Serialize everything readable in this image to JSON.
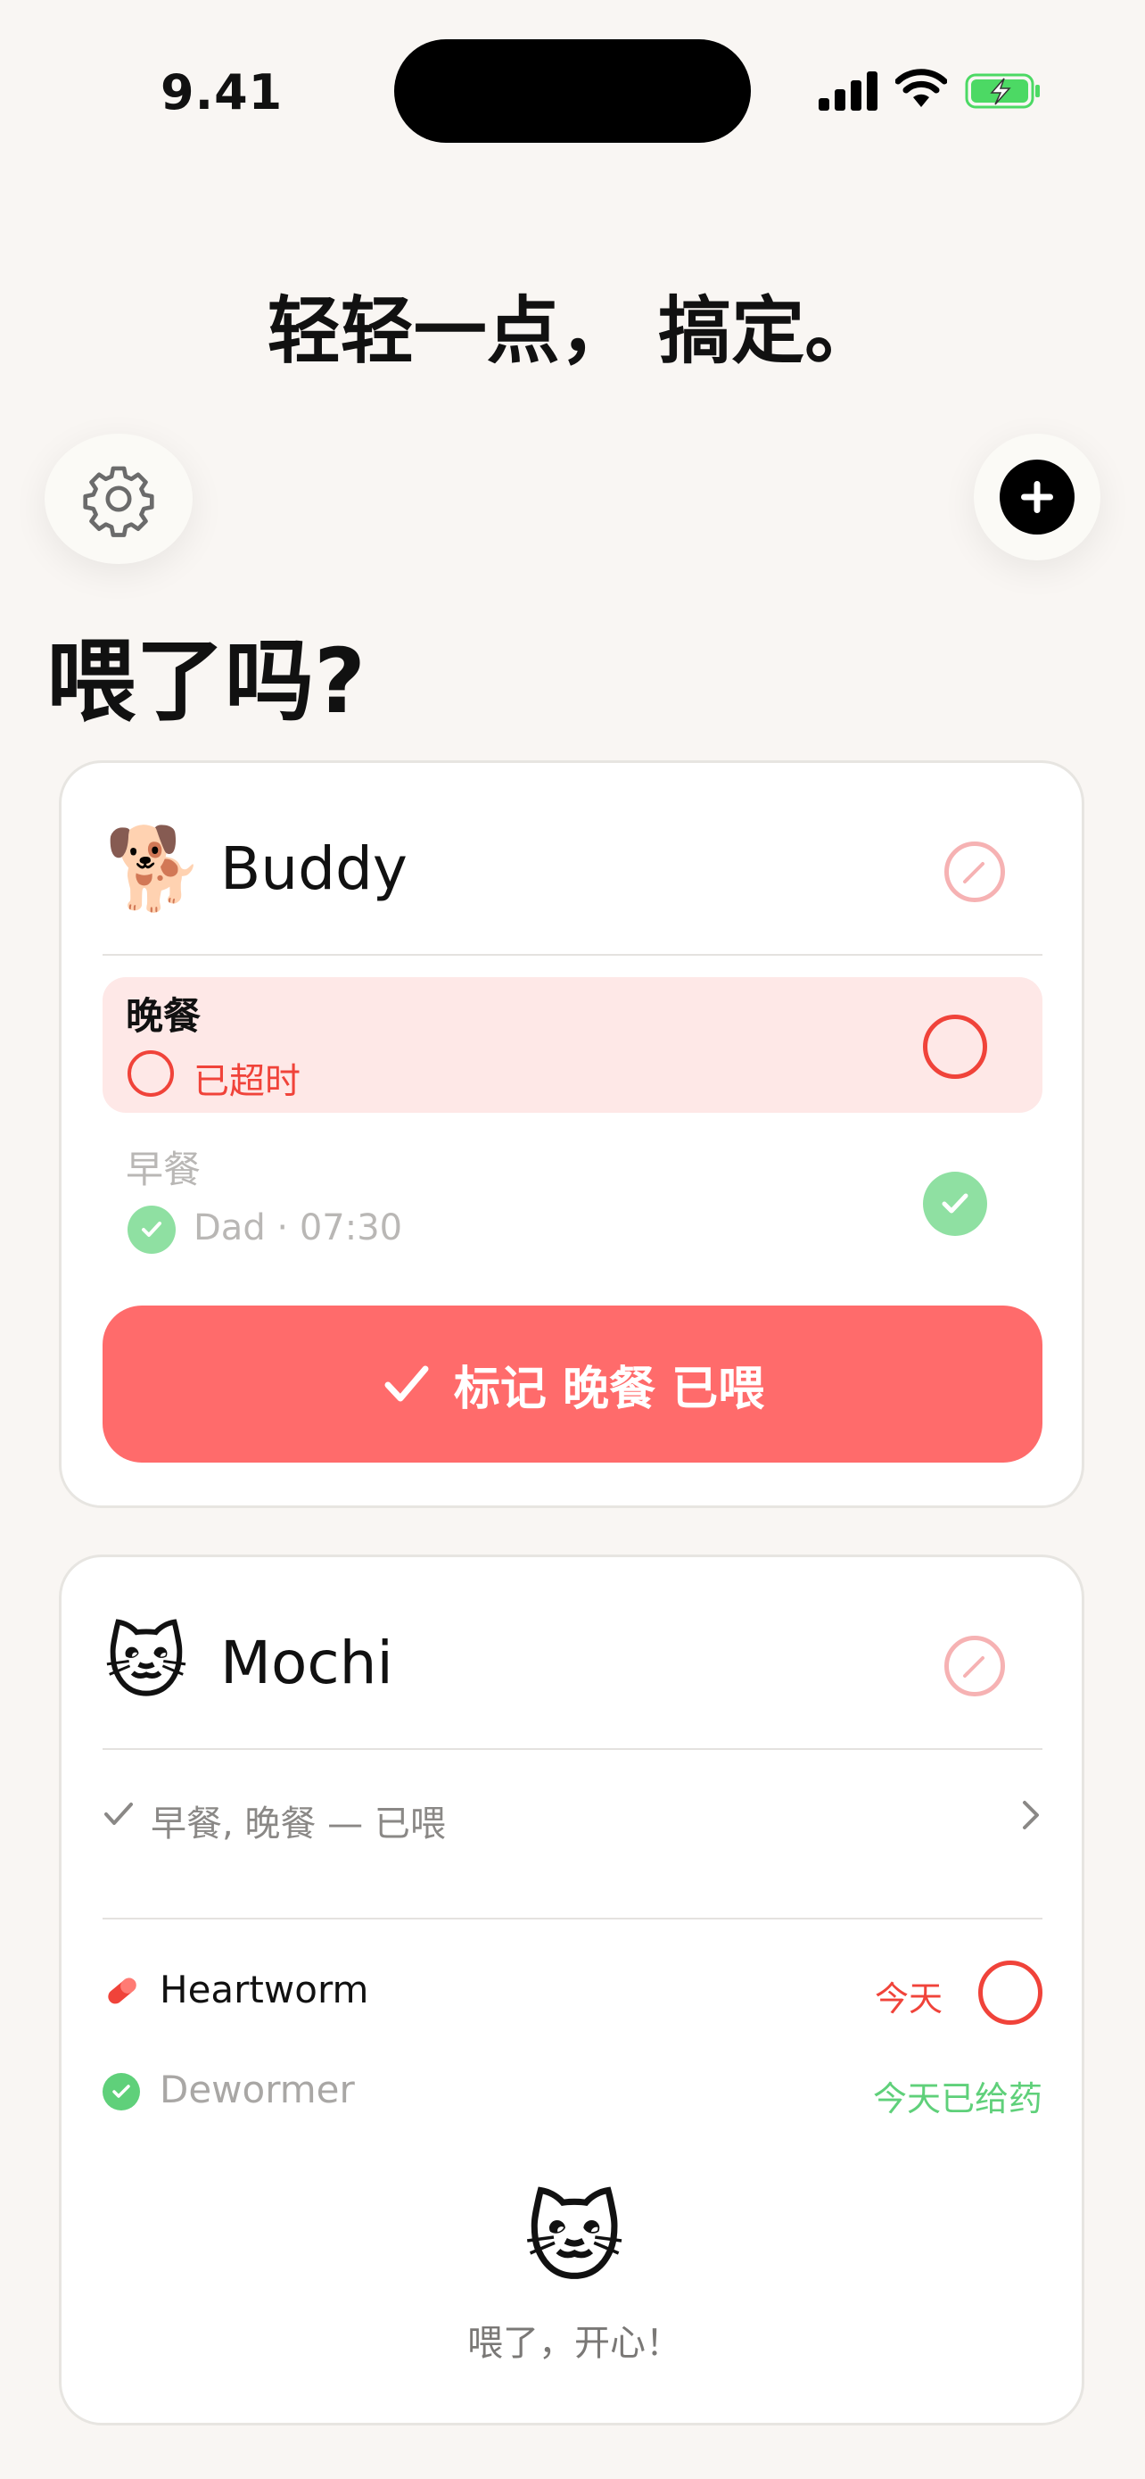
{
  "status_bar": {
    "time": "9.41"
  },
  "headline": "轻轻一点， 搞定。",
  "page_title": "喂了吗?",
  "pets": [
    {
      "emoji": "🐕",
      "name": "Buddy",
      "meals": [
        {
          "name": "晚餐",
          "status": "已超时",
          "state": "overdue"
        },
        {
          "name": "早餐",
          "status": "Dad · 07:30",
          "state": "done"
        }
      ],
      "action_label": "标记 晚餐 已喂"
    },
    {
      "emoji": "🐱",
      "name": "Mochi",
      "fed_summary": "早餐, 晚餐 — 已喂",
      "medications": [
        {
          "name": "Heartworm",
          "tag": "今天",
          "state": "due"
        },
        {
          "name": "Dewormer",
          "tag": "今天已给药",
          "state": "given"
        }
      ],
      "happy_emoji": "🐱",
      "happy_text": "喂了，开心！"
    }
  ],
  "colors": {
    "accent": "#ff6b6b",
    "overdue": "#f0433a",
    "done": "#34c759",
    "background": "#f9f6f3"
  }
}
